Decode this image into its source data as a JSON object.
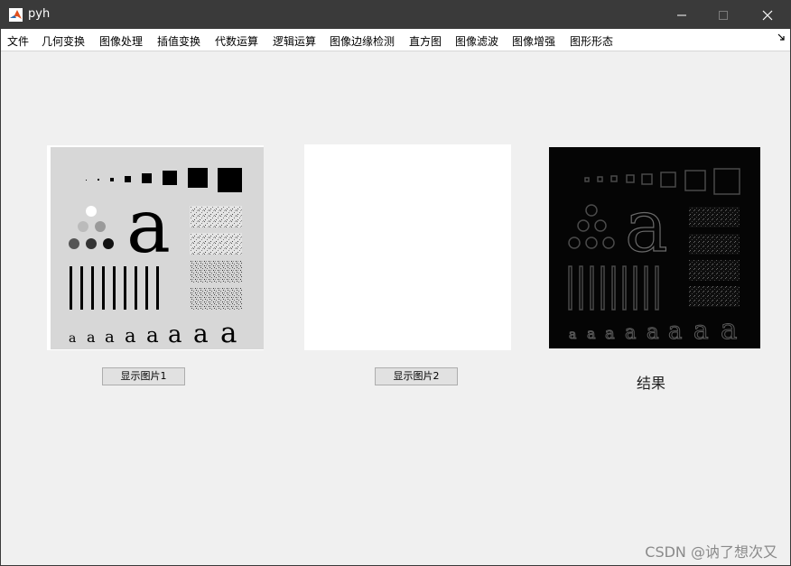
{
  "window": {
    "title": "pyh",
    "app_icon": "matlab-icon",
    "controls": [
      "minimize-icon",
      "maximize-icon",
      "close-icon"
    ]
  },
  "menu": {
    "items": [
      "文件",
      "几何变换",
      "图像处理",
      "插值变换",
      "代数运算",
      "逻辑运算",
      "图像边缘检测",
      "直方图",
      "图像滤波",
      "图像增强",
      "图形形态"
    ],
    "overflow_icon": "dock-arrow-icon"
  },
  "panels": {
    "image1": {
      "description_icon": "test-pattern-image",
      "button_label": "显示图片1"
    },
    "image2": {
      "button_label": "显示图片2"
    },
    "result": {
      "label": "结果"
    }
  },
  "watermark": "CSDN @讷了想次又",
  "colors": {
    "titlebar": "#3a3a3a",
    "background": "#f0f0f0",
    "menubar": "#ffffff"
  }
}
